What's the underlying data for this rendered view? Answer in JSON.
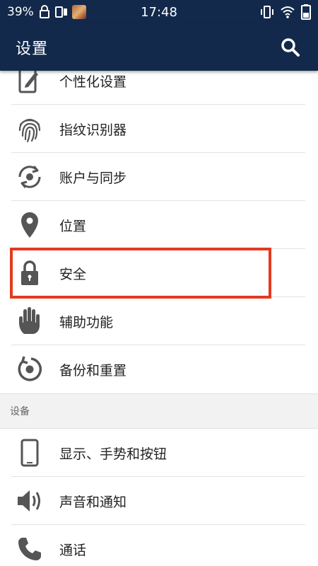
{
  "status_bar": {
    "battery_percent": "39%",
    "time": "17:48"
  },
  "header": {
    "title": "设置",
    "search_icon": "search-icon"
  },
  "settings_items": [
    {
      "label": "个性化设置",
      "icon": "personalize-icon"
    },
    {
      "label": "指纹识别器",
      "icon": "fingerprint-icon"
    },
    {
      "label": "账户与同步",
      "icon": "sync-icon"
    },
    {
      "label": "位置",
      "icon": "location-icon"
    },
    {
      "label": "安全",
      "icon": "lock-icon"
    },
    {
      "label": "辅助功能",
      "icon": "hand-icon"
    },
    {
      "label": "备份和重置",
      "icon": "backup-icon"
    }
  ],
  "device_section": {
    "title": "设备",
    "items": [
      {
        "label": "显示、手势和按钮",
        "icon": "phone-display-icon"
      },
      {
        "label": "声音和通知",
        "icon": "speaker-icon"
      },
      {
        "label": "通话",
        "icon": "phone-call-icon"
      }
    ]
  },
  "colors": {
    "app_bar": "#13294b",
    "icon_gray": "#555555",
    "highlight": "#e23a1e"
  }
}
